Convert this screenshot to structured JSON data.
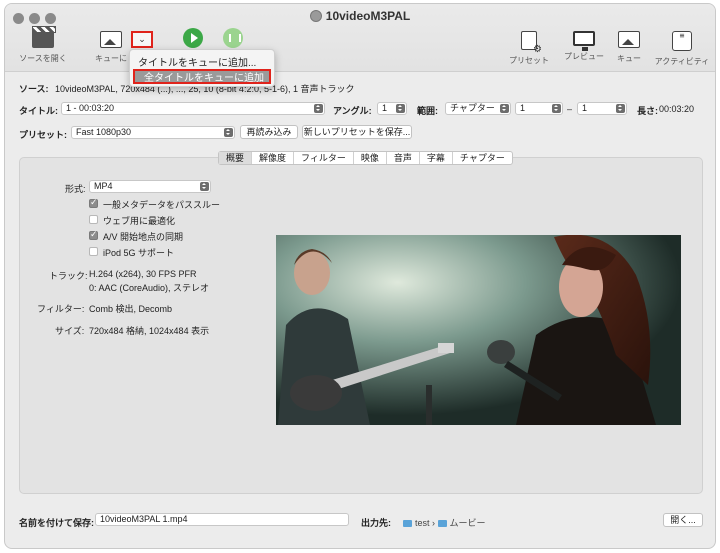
{
  "window": {
    "title": "10videoM3PAL"
  },
  "toolbar": {
    "open_source": "ソースを開く",
    "add_queue": "キューに",
    "presets": "プリセット",
    "preview": "プレビュー",
    "queue": "キュー",
    "activity": "アクティビティ"
  },
  "menu": {
    "item1": "タイトルをキューに追加...",
    "item2": "全タイトルをキューに追加"
  },
  "source": {
    "label": "ソース:",
    "value": "10videoM3PAL, 720x484 (...), ..., 25, 10 (8-bit 4:2:0, 5-1-6), 1 音声トラック"
  },
  "title_row": {
    "label": "タイトル:",
    "value": "1 - 00:03:20",
    "angle_label": "アングル:",
    "angle_value": "1",
    "range_label": "範囲:",
    "range_type": "チャプター",
    "range_start": "1",
    "dash": "–",
    "range_end": "1",
    "duration_label": "長さ:",
    "duration_value": "00:03:20"
  },
  "preset_row": {
    "label": "プリセット:",
    "value": "Fast 1080p30",
    "reload_button": "再読み込み",
    "new_preset_button": "新しいプリセットを保存..."
  },
  "tabs": [
    "概要",
    "解像度",
    "フィルター",
    "映像",
    "音声",
    "字幕",
    "チャプター"
  ],
  "summary": {
    "format_label": "形式:",
    "format_value": "MP4",
    "options": [
      {
        "label": "一般メタデータをパススルー",
        "checked": true
      },
      {
        "label": "ウェブ用に最適化",
        "checked": false
      },
      {
        "label": "A/V 開始地点の同期",
        "checked": true
      },
      {
        "label": "iPod 5G サポート",
        "checked": false
      }
    ],
    "tracks_label": "トラック:",
    "tracks_line1": "H.264 (x264), 30 FPS PFR",
    "tracks_line2": "0: AAC (CoreAudio), ステレオ",
    "filters_label": "フィルター:",
    "filters_value": "Comb 検出, Decomb",
    "size_label": "サイズ:",
    "size_value": "720x484 格納, 1024x484 表示"
  },
  "save": {
    "label": "名前を付けて保存:",
    "filename": "10videoM3PAL 1.mp4",
    "dest_label": "出力先:",
    "path1": "test",
    "sep": "›",
    "path2": "ムービー",
    "browse_button": "開く..."
  },
  "colors": {
    "accent_red": "#e0231b",
    "start_green": "#3ca847"
  }
}
